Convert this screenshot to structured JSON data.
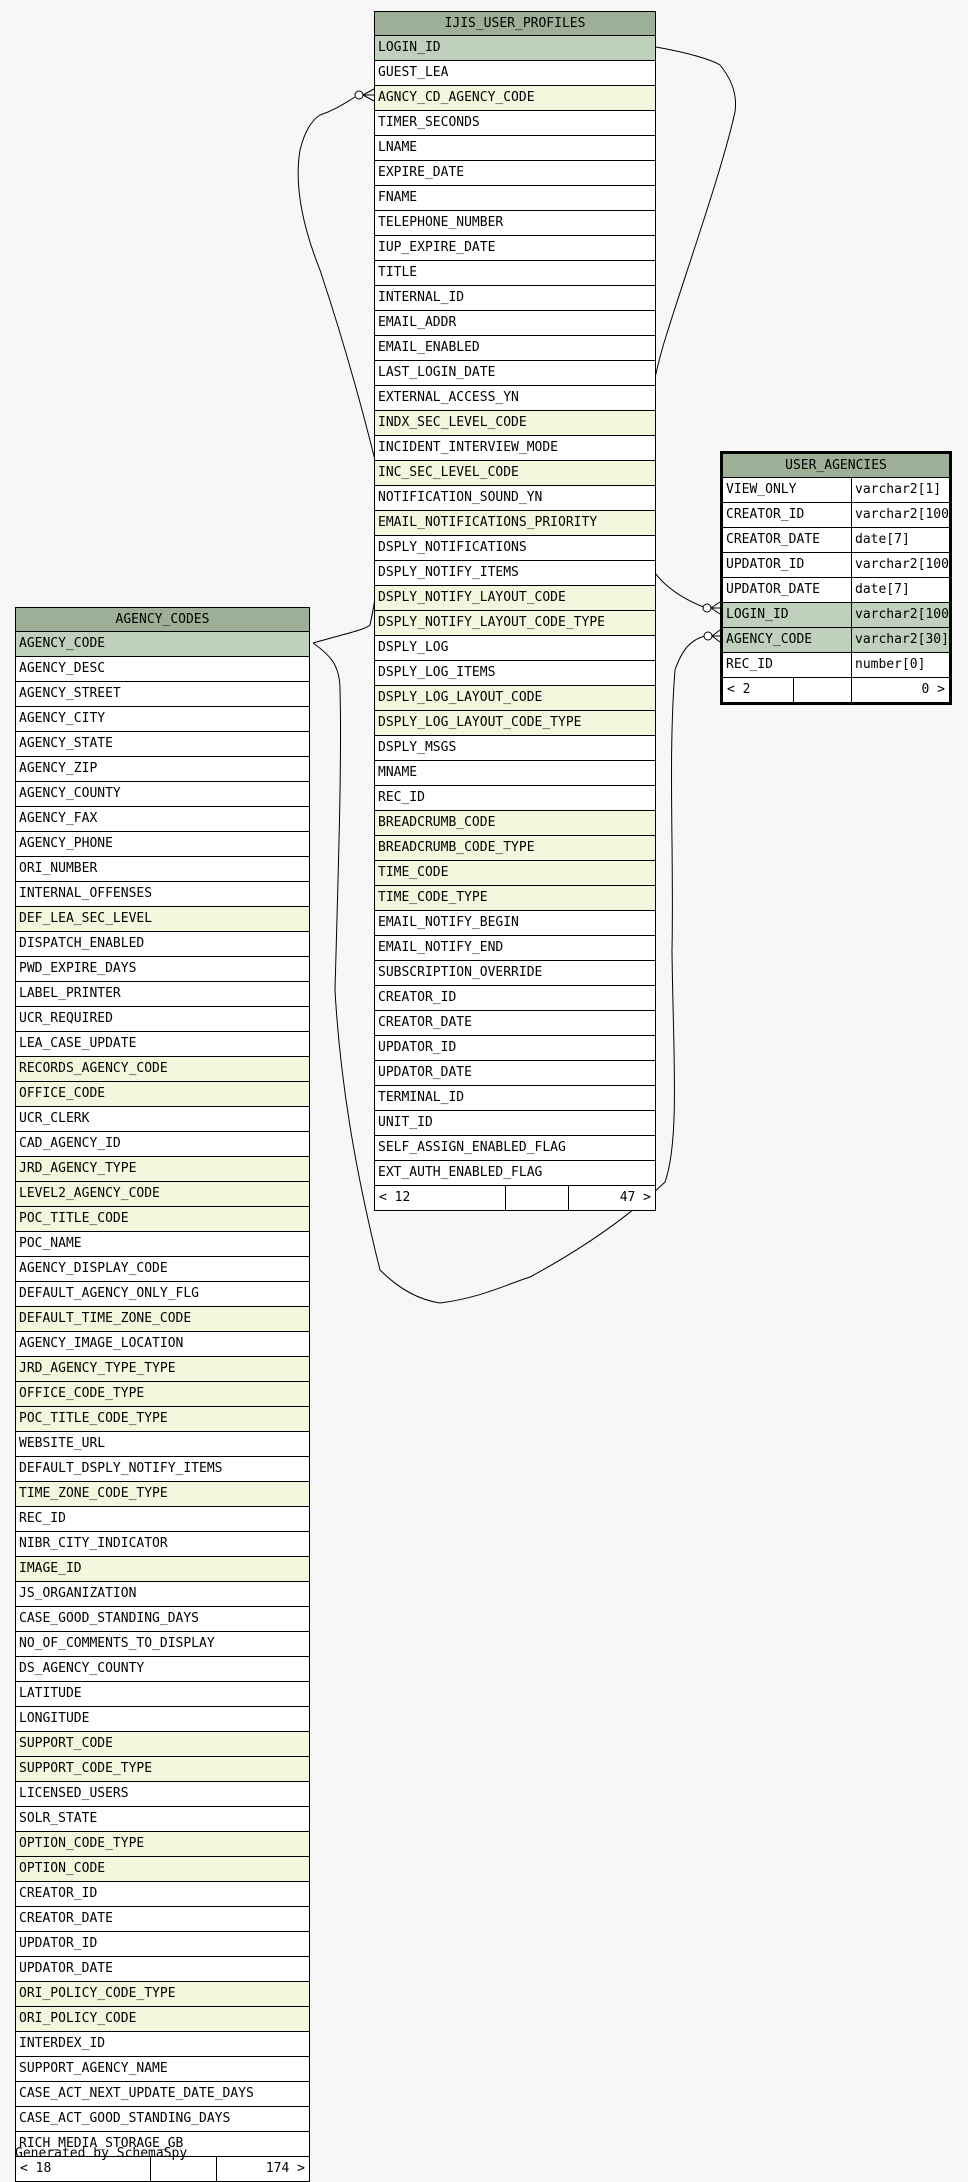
{
  "tables": {
    "ijis": {
      "name": "IJIS_USER_PROFILES",
      "columns": [
        {
          "name": "LOGIN_ID",
          "kind": "pk"
        },
        {
          "name": "GUEST_LEA",
          "kind": ""
        },
        {
          "name": "AGNCY_CD_AGENCY_CODE",
          "kind": "fk"
        },
        {
          "name": "TIMER_SECONDS",
          "kind": ""
        },
        {
          "name": "LNAME",
          "kind": ""
        },
        {
          "name": "EXPIRE_DATE",
          "kind": ""
        },
        {
          "name": "FNAME",
          "kind": ""
        },
        {
          "name": "TELEPHONE_NUMBER",
          "kind": ""
        },
        {
          "name": "IUP_EXPIRE_DATE",
          "kind": ""
        },
        {
          "name": "TITLE",
          "kind": ""
        },
        {
          "name": "INTERNAL_ID",
          "kind": ""
        },
        {
          "name": "EMAIL_ADDR",
          "kind": ""
        },
        {
          "name": "EMAIL_ENABLED",
          "kind": ""
        },
        {
          "name": "LAST_LOGIN_DATE",
          "kind": ""
        },
        {
          "name": "EXTERNAL_ACCESS_YN",
          "kind": ""
        },
        {
          "name": "INDX_SEC_LEVEL_CODE",
          "kind": "fk"
        },
        {
          "name": "INCIDENT_INTERVIEW_MODE",
          "kind": ""
        },
        {
          "name": "INC_SEC_LEVEL_CODE",
          "kind": "fk"
        },
        {
          "name": "NOTIFICATION_SOUND_YN",
          "kind": ""
        },
        {
          "name": "EMAIL_NOTIFICATIONS_PRIORITY",
          "kind": "fk"
        },
        {
          "name": "DSPLY_NOTIFICATIONS",
          "kind": ""
        },
        {
          "name": "DSPLY_NOTIFY_ITEMS",
          "kind": ""
        },
        {
          "name": "DSPLY_NOTIFY_LAYOUT_CODE",
          "kind": "fk"
        },
        {
          "name": "DSPLY_NOTIFY_LAYOUT_CODE_TYPE",
          "kind": "fk"
        },
        {
          "name": "DSPLY_LOG",
          "kind": ""
        },
        {
          "name": "DSPLY_LOG_ITEMS",
          "kind": ""
        },
        {
          "name": "DSPLY_LOG_LAYOUT_CODE",
          "kind": "fk"
        },
        {
          "name": "DSPLY_LOG_LAYOUT_CODE_TYPE",
          "kind": "fk"
        },
        {
          "name": "DSPLY_MSGS",
          "kind": ""
        },
        {
          "name": "MNAME",
          "kind": ""
        },
        {
          "name": "REC_ID",
          "kind": ""
        },
        {
          "name": "BREADCRUMB_CODE",
          "kind": "fk"
        },
        {
          "name": "BREADCRUMB_CODE_TYPE",
          "kind": "fk"
        },
        {
          "name": "TIME_CODE",
          "kind": "fk"
        },
        {
          "name": "TIME_CODE_TYPE",
          "kind": "fk"
        },
        {
          "name": "EMAIL_NOTIFY_BEGIN",
          "kind": ""
        },
        {
          "name": "EMAIL_NOTIFY_END",
          "kind": ""
        },
        {
          "name": "SUBSCRIPTION_OVERRIDE",
          "kind": ""
        },
        {
          "name": "CREATOR_ID",
          "kind": ""
        },
        {
          "name": "CREATOR_DATE",
          "kind": ""
        },
        {
          "name": "UPDATOR_ID",
          "kind": ""
        },
        {
          "name": "UPDATOR_DATE",
          "kind": ""
        },
        {
          "name": "TERMINAL_ID",
          "kind": ""
        },
        {
          "name": "UNIT_ID",
          "kind": ""
        },
        {
          "name": "SELF_ASSIGN_ENABLED_FLAG",
          "kind": ""
        },
        {
          "name": "EXT_AUTH_ENABLED_FLAG",
          "kind": ""
        }
      ],
      "footer": {
        "left": "< 12",
        "right": "47 >"
      }
    },
    "user_agencies": {
      "name": "USER_AGENCIES",
      "columns": [
        {
          "name": "VIEW_ONLY",
          "type": "varchar2[1]",
          "kind": ""
        },
        {
          "name": "CREATOR_ID",
          "type": "varchar2[100]",
          "kind": ""
        },
        {
          "name": "CREATOR_DATE",
          "type": "date[7]",
          "kind": ""
        },
        {
          "name": "UPDATOR_ID",
          "type": "varchar2[100]",
          "kind": ""
        },
        {
          "name": "UPDATOR_DATE",
          "type": "date[7]",
          "kind": ""
        },
        {
          "name": "LOGIN_ID",
          "type": "varchar2[100]",
          "kind": "pk"
        },
        {
          "name": "AGENCY_CODE",
          "type": "varchar2[30]",
          "kind": "pk"
        },
        {
          "name": "REC_ID",
          "type": "number[0]",
          "kind": ""
        }
      ],
      "footer": {
        "left": "< 2",
        "right": "0 >"
      }
    },
    "agency_codes": {
      "name": "AGENCY_CODES",
      "columns": [
        {
          "name": "AGENCY_CODE",
          "kind": "pk"
        },
        {
          "name": "AGENCY_DESC",
          "kind": ""
        },
        {
          "name": "AGENCY_STREET",
          "kind": ""
        },
        {
          "name": "AGENCY_CITY",
          "kind": ""
        },
        {
          "name": "AGENCY_STATE",
          "kind": ""
        },
        {
          "name": "AGENCY_ZIP",
          "kind": ""
        },
        {
          "name": "AGENCY_COUNTY",
          "kind": ""
        },
        {
          "name": "AGENCY_FAX",
          "kind": ""
        },
        {
          "name": "AGENCY_PHONE",
          "kind": ""
        },
        {
          "name": "ORI_NUMBER",
          "kind": ""
        },
        {
          "name": "INTERNAL_OFFENSES",
          "kind": ""
        },
        {
          "name": "DEF_LEA_SEC_LEVEL",
          "kind": "fk"
        },
        {
          "name": "DISPATCH_ENABLED",
          "kind": ""
        },
        {
          "name": "PWD_EXPIRE_DAYS",
          "kind": ""
        },
        {
          "name": "LABEL_PRINTER",
          "kind": ""
        },
        {
          "name": "UCR_REQUIRED",
          "kind": ""
        },
        {
          "name": "LEA_CASE_UPDATE",
          "kind": ""
        },
        {
          "name": "RECORDS_AGENCY_CODE",
          "kind": "fk"
        },
        {
          "name": "OFFICE_CODE",
          "kind": "fk"
        },
        {
          "name": "UCR_CLERK",
          "kind": ""
        },
        {
          "name": "CAD_AGENCY_ID",
          "kind": ""
        },
        {
          "name": "JRD_AGENCY_TYPE",
          "kind": "fk"
        },
        {
          "name": "LEVEL2_AGENCY_CODE",
          "kind": "fk"
        },
        {
          "name": "POC_TITLE_CODE",
          "kind": "fk"
        },
        {
          "name": "POC_NAME",
          "kind": ""
        },
        {
          "name": "AGENCY_DISPLAY_CODE",
          "kind": ""
        },
        {
          "name": "DEFAULT_AGENCY_ONLY_FLG",
          "kind": ""
        },
        {
          "name": "DEFAULT_TIME_ZONE_CODE",
          "kind": "fk"
        },
        {
          "name": "AGENCY_IMAGE_LOCATION",
          "kind": ""
        },
        {
          "name": "JRD_AGENCY_TYPE_TYPE",
          "kind": "fk"
        },
        {
          "name": "OFFICE_CODE_TYPE",
          "kind": "fk"
        },
        {
          "name": "POC_TITLE_CODE_TYPE",
          "kind": "fk"
        },
        {
          "name": "WEBSITE_URL",
          "kind": ""
        },
        {
          "name": "DEFAULT_DSPLY_NOTIFY_ITEMS",
          "kind": ""
        },
        {
          "name": "TIME_ZONE_CODE_TYPE",
          "kind": "fk"
        },
        {
          "name": "REC_ID",
          "kind": ""
        },
        {
          "name": "NIBR_CITY_INDICATOR",
          "kind": ""
        },
        {
          "name": "IMAGE_ID",
          "kind": "fk"
        },
        {
          "name": "JS_ORGANIZATION",
          "kind": ""
        },
        {
          "name": "CASE_GOOD_STANDING_DAYS",
          "kind": ""
        },
        {
          "name": "NO_OF_COMMENTS_TO_DISPLAY",
          "kind": ""
        },
        {
          "name": "DS_AGENCY_COUNTY",
          "kind": ""
        },
        {
          "name": "LATITUDE",
          "kind": ""
        },
        {
          "name": "LONGITUDE",
          "kind": ""
        },
        {
          "name": "SUPPORT_CODE",
          "kind": "fk"
        },
        {
          "name": "SUPPORT_CODE_TYPE",
          "kind": "fk"
        },
        {
          "name": "LICENSED_USERS",
          "kind": ""
        },
        {
          "name": "SOLR_STATE",
          "kind": ""
        },
        {
          "name": "OPTION_CODE_TYPE",
          "kind": "fk"
        },
        {
          "name": "OPTION_CODE",
          "kind": "fk"
        },
        {
          "name": "CREATOR_ID",
          "kind": ""
        },
        {
          "name": "CREATOR_DATE",
          "kind": ""
        },
        {
          "name": "UPDATOR_ID",
          "kind": ""
        },
        {
          "name": "UPDATOR_DATE",
          "kind": ""
        },
        {
          "name": "ORI_POLICY_CODE_TYPE",
          "kind": "fk"
        },
        {
          "name": "ORI_POLICY_CODE",
          "kind": "fk"
        },
        {
          "name": "INTERDEX_ID",
          "kind": ""
        },
        {
          "name": "SUPPORT_AGENCY_NAME",
          "kind": ""
        },
        {
          "name": "CASE_ACT_NEXT_UPDATE_DATE_DAYS",
          "kind": ""
        },
        {
          "name": "CASE_ACT_GOOD_STANDING_DAYS",
          "kind": ""
        },
        {
          "name": "RICH_MEDIA_STORAGE_GB",
          "kind": ""
        }
      ],
      "footer": {
        "left": "< 18",
        "right": "174 >"
      }
    }
  },
  "generated_by": "Generated by SchemaSpy"
}
